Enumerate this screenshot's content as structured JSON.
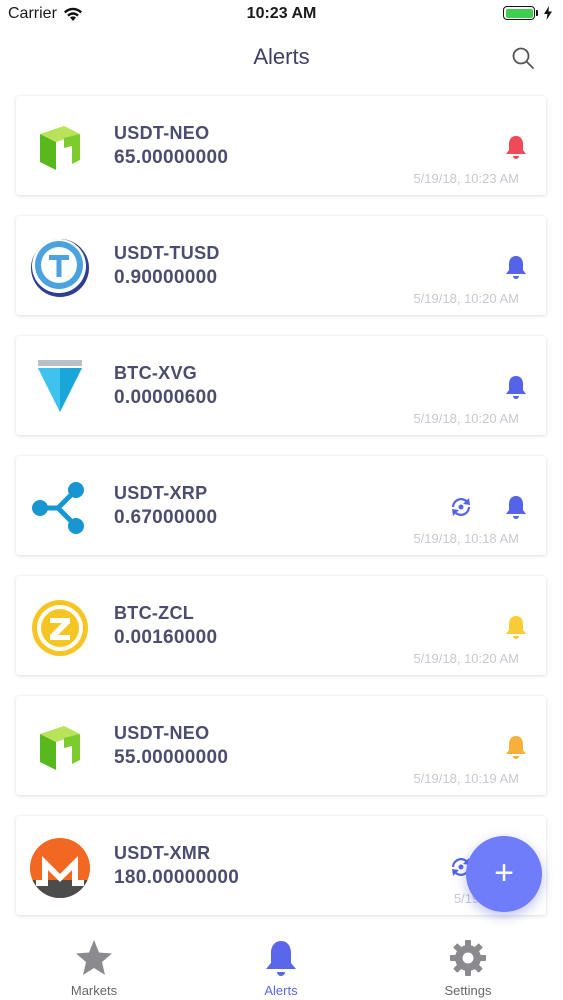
{
  "status_bar": {
    "carrier": "Carrier",
    "time": "10:23 AM"
  },
  "header": {
    "title": "Alerts"
  },
  "alerts": [
    {
      "pair": "USDT-NEO",
      "price": "65.00000000",
      "time": "5/19/18, 10:23 AM",
      "coin_icon": "neo-logo",
      "bell_color": "#ef4a5a",
      "repeat": false
    },
    {
      "pair": "USDT-TUSD",
      "price": "0.90000000",
      "time": "5/19/18, 10:20 AM",
      "coin_icon": "tusd-logo",
      "bell_color": "#5563e8",
      "repeat": false
    },
    {
      "pair": "BTC-XVG",
      "price": "0.00000600",
      "time": "5/19/18, 10:20 AM",
      "coin_icon": "verge-logo",
      "bell_color": "#5563e8",
      "repeat": false
    },
    {
      "pair": "USDT-XRP",
      "price": "0.67000000",
      "time": "5/19/18, 10:18 AM",
      "coin_icon": "ripple-logo",
      "bell_color": "#5563e8",
      "repeat": true
    },
    {
      "pair": "BTC-ZCL",
      "price": "0.00160000",
      "time": "5/19/18, 10:20 AM",
      "coin_icon": "zclassic-logo",
      "bell_color": "#f7cc34",
      "repeat": false
    },
    {
      "pair": "USDT-NEO",
      "price": "55.00000000",
      "time": "5/19/18, 10:19 AM",
      "coin_icon": "neo-logo",
      "bell_color": "#f7b13a",
      "repeat": false
    },
    {
      "pair": "USDT-XMR",
      "price": "180.00000000",
      "time": "5/19/18, 10",
      "coin_icon": "monero-logo",
      "bell_color": "#5563e8",
      "repeat": true
    }
  ],
  "fab": {
    "label": "+"
  },
  "tabs": [
    {
      "label": "Markets",
      "icon": "star-icon",
      "active": false
    },
    {
      "label": "Alerts",
      "icon": "bell-icon",
      "active": true
    },
    {
      "label": "Settings",
      "icon": "gear-icon",
      "active": false
    }
  ],
  "colors": {
    "accent": "#5a67ea",
    "fab": "#6f7dfb",
    "text": "#4b4d6e",
    "muted": "#c7c8d2"
  }
}
